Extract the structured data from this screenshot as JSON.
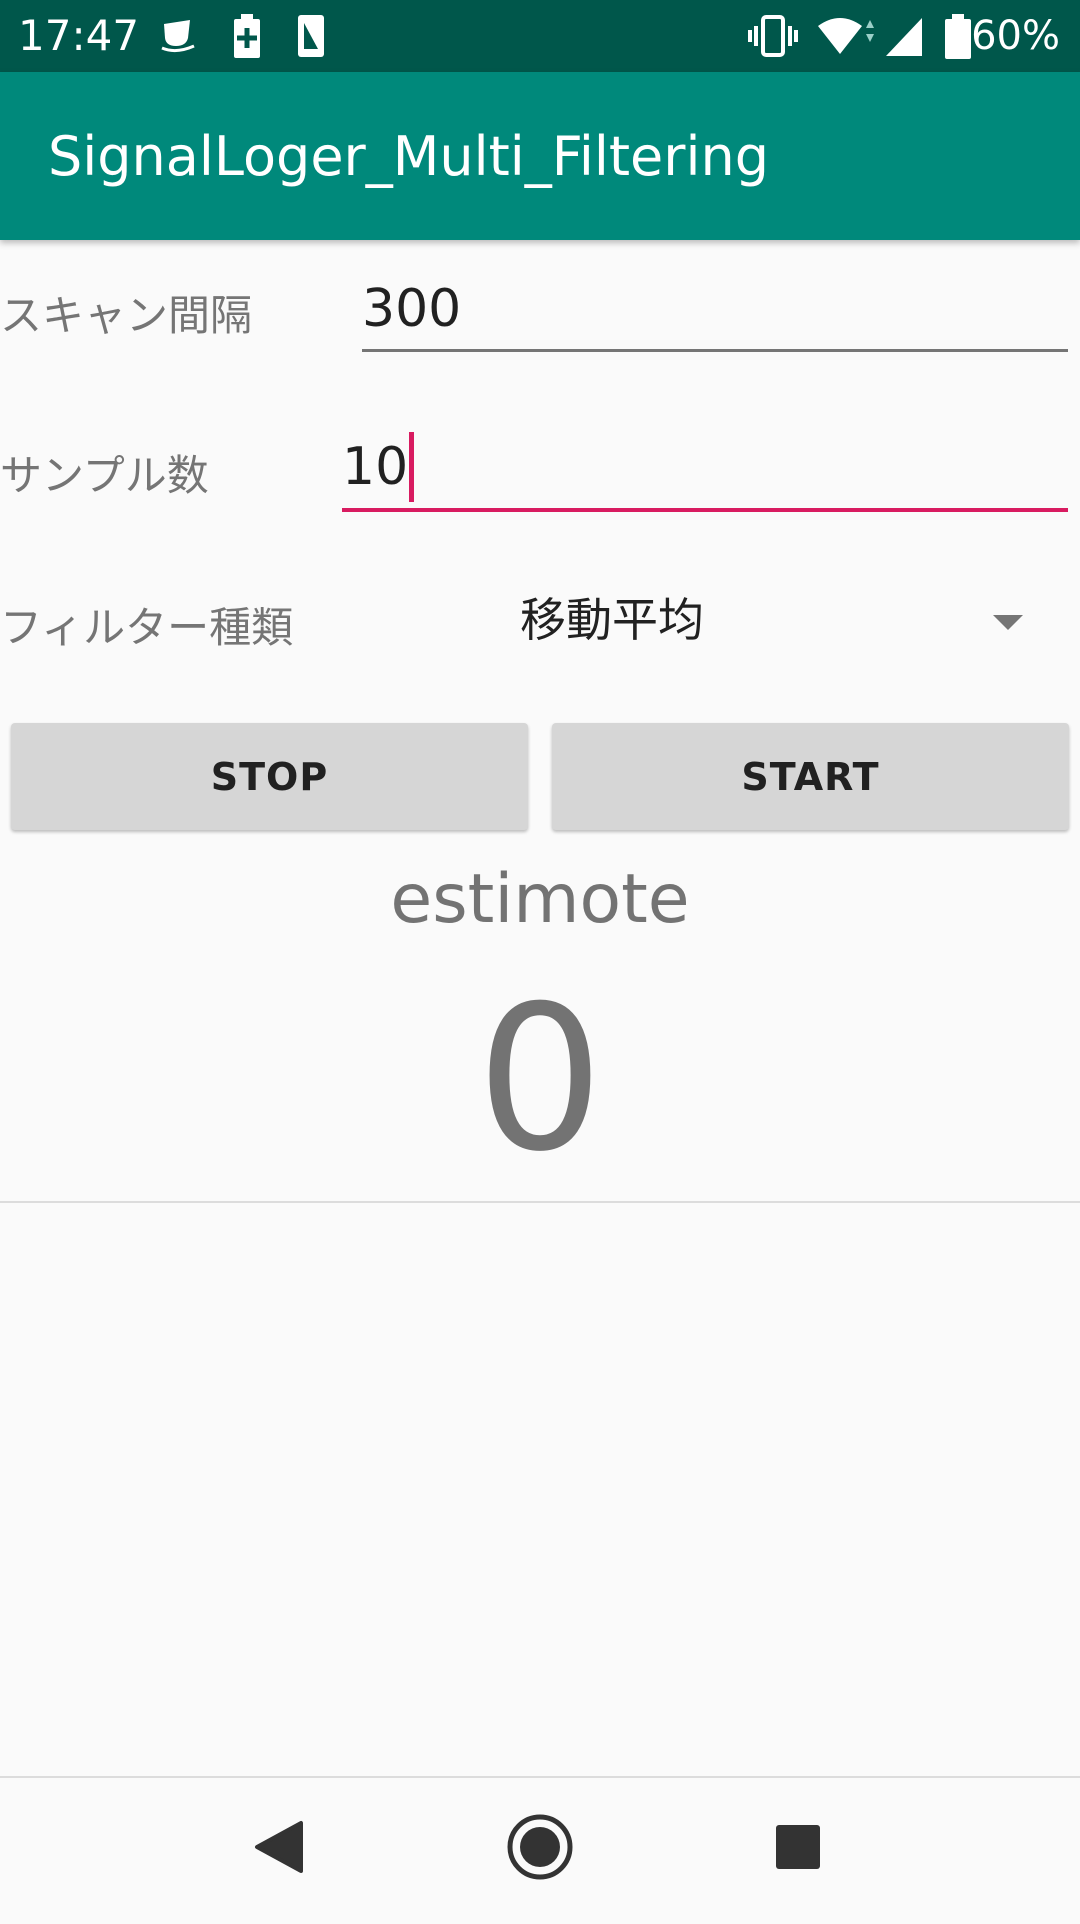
{
  "status_bar": {
    "time": "17:47",
    "battery_percent": "60%",
    "icons": [
      "notification-cup-icon",
      "battery-saver-icon",
      "screenshot-icon",
      "vibrate-icon",
      "wifi-icon",
      "signal-icon",
      "battery-icon"
    ]
  },
  "app_bar": {
    "title": "SignalLoger_Multi_Filtering"
  },
  "form": {
    "scan_interval_label": "スキャン間隔",
    "scan_interval_value": "300",
    "sample_count_label": "サンプル数",
    "sample_count_value": "10",
    "filter_type_label": "フィルター種類",
    "filter_type_value": "移動平均"
  },
  "buttons": {
    "stop_label": "STOP",
    "start_label": "START"
  },
  "result": {
    "device_name": "estimote",
    "count": "0"
  },
  "colors": {
    "status_bar": "#00574b",
    "app_bar": "#00897b",
    "accent": "#d81b60"
  }
}
